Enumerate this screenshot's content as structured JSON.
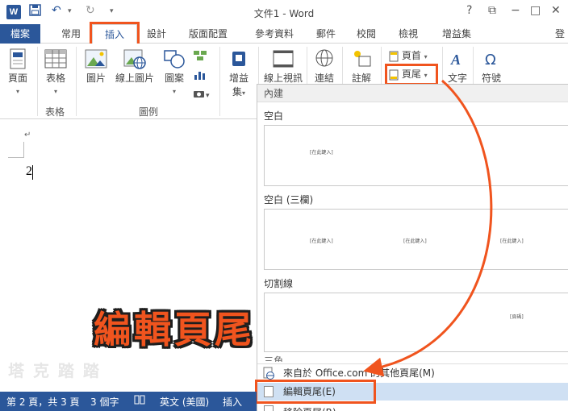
{
  "titlebar": {
    "app_icon": "W",
    "title": "文件1 - Word",
    "help": "?",
    "restore": "⧉",
    "minimize": "−",
    "maximize": "□",
    "close": "✕",
    "account": "登"
  },
  "tabs": [
    "檔案",
    "常用",
    "插入",
    "設計",
    "版面配置",
    "參考資料",
    "郵件",
    "校閱",
    "檢視",
    "增益集"
  ],
  "ribbon": {
    "page": "頁面",
    "table": "表格",
    "table_group": "表格",
    "picture": "圖片",
    "online_picture": "線上圖片",
    "shapes": "圖案",
    "illustrations_group": "圖例",
    "addins": "增益",
    "addins2": "集",
    "online_video": "線上視訊",
    "link": "連結",
    "comment": "註解",
    "header": "頁首",
    "footer": "頁尾",
    "textbox": "文字",
    "symbol": "符號"
  },
  "document": {
    "para_mark": "↵",
    "page_number": "2"
  },
  "dropdown": {
    "builtin_header": "內建",
    "items": [
      {
        "label": "空白",
        "placeholders": [
          "[在此鍵入]"
        ]
      },
      {
        "label": "空白 (三欄)",
        "placeholders": [
          "[在此鍵入]",
          "[在此鍵入]",
          "[在此鍵入]"
        ]
      },
      {
        "label": "切割線",
        "placeholders": [
          "[頁碼]"
        ]
      },
      {
        "label": "三角"
      }
    ],
    "more_from_office": "來自於 Office.com 的其他頁尾(M)",
    "edit_footer": "編輯頁尾(E)",
    "remove_footer": "移除頁尾(R)"
  },
  "annotation": "編輯頁尾",
  "watermark": "塔 克 踏 踏",
  "statusbar": {
    "page": "第 2 頁，共 3 頁",
    "words": "3 個字",
    "proof_icon": "📖",
    "language": "英文 (美國)",
    "mode": "插入"
  },
  "colors": {
    "brand": "#2b579a",
    "highlight": "#f0541e",
    "selection": "#cfe0f3"
  }
}
